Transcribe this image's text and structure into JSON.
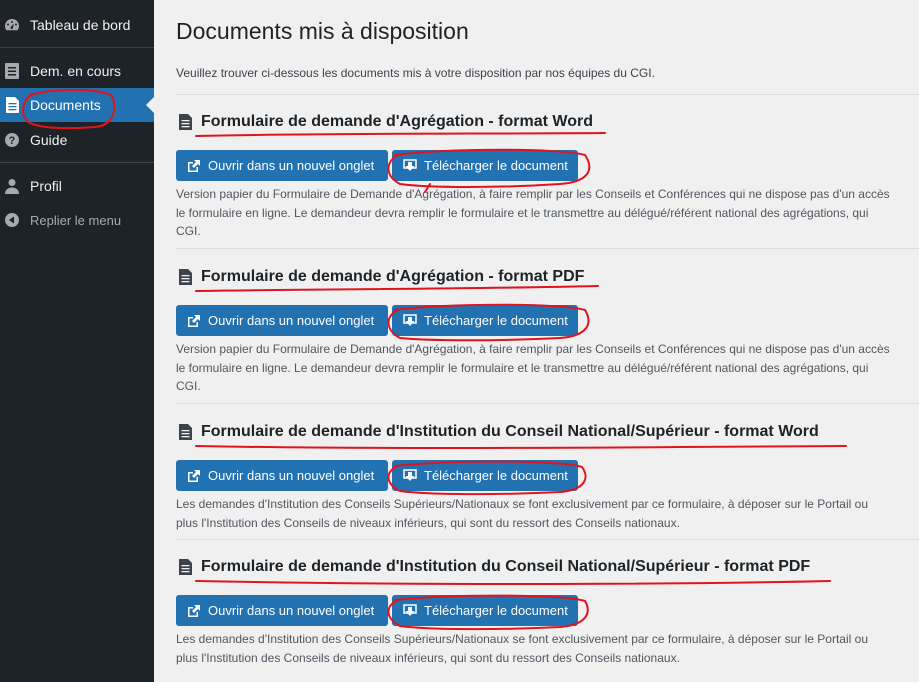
{
  "sidebar": {
    "items": [
      {
        "label": "Tableau de bord",
        "icon": "dashboard-icon"
      },
      {
        "label": "Dem. en cours",
        "icon": "list-icon"
      },
      {
        "label": "Documents",
        "icon": "document-icon",
        "active": true
      },
      {
        "label": "Guide",
        "icon": "help-icon"
      },
      {
        "label": "Profil",
        "icon": "user-icon"
      },
      {
        "label": "Replier le menu",
        "icon": "collapse-icon"
      }
    ]
  },
  "main": {
    "title": "Documents mis à disposition",
    "intro": "Veuillez trouver ci-dessous les documents mis à votre disposition par nos équipes du CGI.",
    "documents": [
      {
        "title": "Formulaire de demande d'Agrégation - format Word",
        "open_label": "Ouvrir dans un nouvel onglet",
        "download_label": "Télécharger le document",
        "desc": [
          "Version papier du Formulaire de Demande d'Agrégation, à faire remplir par les Conseils et Conférences qui ne dispose pas d'un accès",
          "le formulaire en ligne. Le demandeur devra remplir le formulaire et le transmettre au délégué/référent national des agrégations, qui",
          "CGI."
        ]
      },
      {
        "title": "Formulaire de demande d'Agrégation - format PDF",
        "open_label": "Ouvrir dans un nouvel onglet",
        "download_label": "Télécharger le document",
        "desc": [
          "Version papier du Formulaire de Demande d'Agrégation, à faire remplir par les Conseils et Conférences qui ne dispose pas d'un accès",
          "le formulaire en ligne. Le demandeur devra remplir le formulaire et le transmettre au délégué/référent national des agrégations, qui",
          "CGI."
        ]
      },
      {
        "title": "Formulaire de demande d'Institution du Conseil National/Supérieur - format Word",
        "open_label": "Ouvrir dans un nouvel onglet",
        "download_label": "Télécharger le document",
        "desc": [
          "Les demandes d'Institution des Conseils Supérieurs/Nationaux se font exclusivement par ce formulaire, à déposer sur le Portail ou",
          "plus l'Institution des Conseils de niveaux inférieurs, qui sont du ressort des Conseils nationaux."
        ]
      },
      {
        "title": "Formulaire de demande d'Institution du Conseil National/Supérieur - format PDF",
        "open_label": "Ouvrir dans un nouvel onglet",
        "download_label": "Télécharger le document",
        "desc": [
          "Les demandes d'Institution des Conseils Supérieurs/Nationaux se font exclusivement par ce formulaire, à déposer sur le Portail ou",
          "plus l'Institution des Conseils de niveaux inférieurs, qui sont du ressort des Conseils nationaux."
        ]
      }
    ]
  },
  "colors": {
    "sidebar_bg": "#1d2327",
    "accent": "#2271b1",
    "annotation": "#e0141e"
  }
}
